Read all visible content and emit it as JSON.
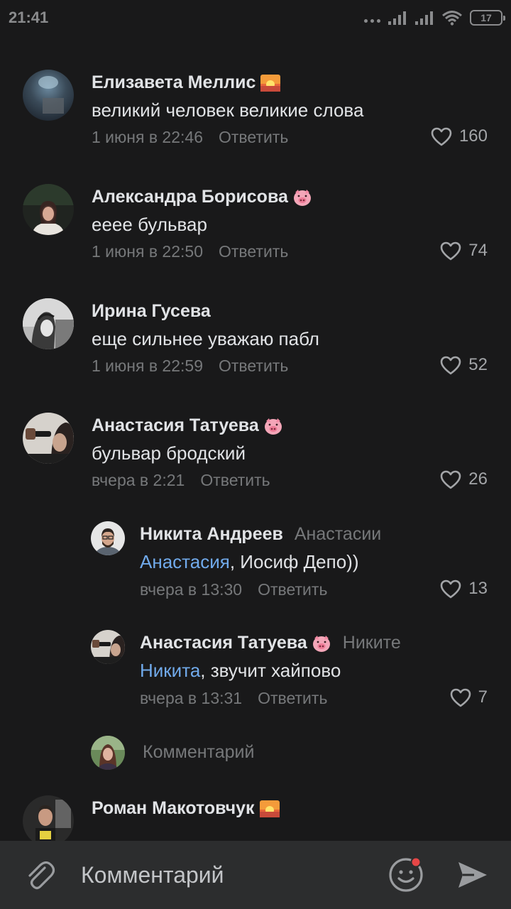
{
  "status_bar": {
    "time": "21:41",
    "battery": "17"
  },
  "comments": [
    {
      "author": "Елизавета Меллис",
      "badge": "sunset-emoji",
      "text": "великий человек великие слова",
      "date": "1 июня в 22:46",
      "reply_label": "Ответить",
      "likes": "160"
    },
    {
      "author": "Александра Борисова",
      "badge": "pig-emoji",
      "text": "ееее бульвар",
      "date": "1 июня в 22:50",
      "reply_label": "Ответить",
      "likes": "74"
    },
    {
      "author": "Ирина Гусева",
      "text": "еще сильнее уважаю пабл",
      "date": "1 июня в 22:59",
      "reply_label": "Ответить",
      "likes": "52"
    },
    {
      "author": "Анастасия Татуева",
      "badge": "pig-emoji",
      "text": "бульвар бродский",
      "date": "вчера в 2:21",
      "reply_label": "Ответить",
      "likes": "26"
    },
    {
      "author": "Роман Макотовчук",
      "badge": "sunset-emoji"
    }
  ],
  "replies": [
    {
      "author": "Никита Андреев",
      "reply_to": "Анастасии",
      "mention": "Анастасия",
      "text": ", Иосиф Депо))",
      "date": "вчера в 13:30",
      "reply_label": "Ответить",
      "likes": "13"
    },
    {
      "author": "Анастасия Татуева",
      "badge": "pig-emoji",
      "reply_to": "Никите",
      "mention": "Никита",
      "text": ", звучит хайпово",
      "date": "вчера в 13:31",
      "reply_label": "Ответить",
      "likes": "7"
    }
  ],
  "inline_reply": {
    "placeholder": "Комментарий"
  },
  "input_bar": {
    "placeholder": "Комментарий"
  },
  "colors": {
    "background": "#19191a",
    "input_bar": "#2c2d2e",
    "text": "#e1e3e6",
    "secondary": "#76787a",
    "link": "#71aaeb",
    "badge_dot": "#e64646"
  }
}
